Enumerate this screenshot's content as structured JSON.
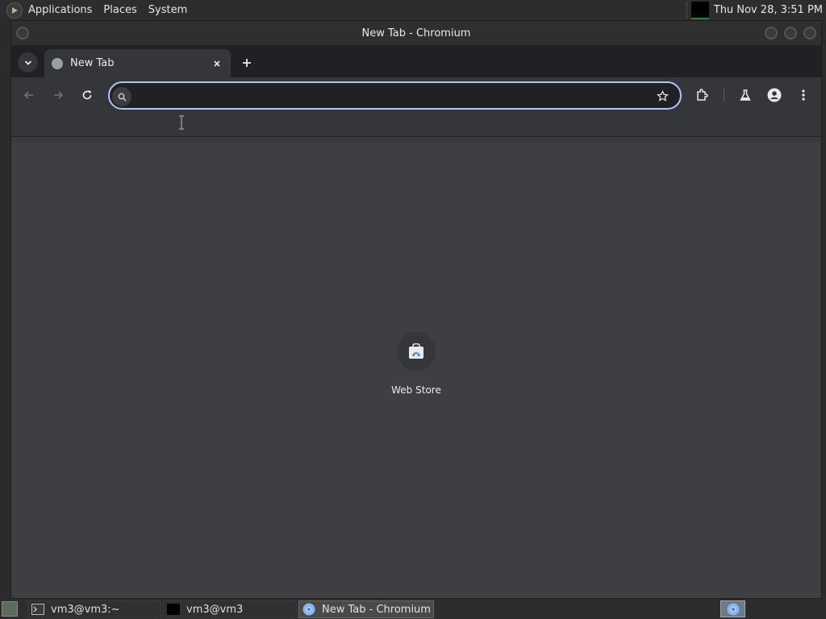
{
  "top_panel": {
    "menus": [
      "Applications",
      "Places",
      "System"
    ],
    "clock": "Thu Nov 28,  3:51 PM"
  },
  "window": {
    "title": "New Tab - Chromium"
  },
  "tabs": [
    {
      "label": "New Tab",
      "active": true
    }
  ],
  "omnibox": {
    "value": "",
    "placeholder": ""
  },
  "new_tab_page": {
    "shortcuts": [
      {
        "label": "Web Store",
        "icon": "web-store-icon"
      }
    ]
  },
  "taskbar": {
    "tasks": [
      {
        "label": "vm3@vm3:~",
        "icon": "terminal-icon",
        "active": false
      },
      {
        "label": "vm3@vm3",
        "icon": "terminal-black-icon",
        "active": false
      },
      {
        "label": "New Tab - Chromium",
        "icon": "chromium-icon",
        "active": true
      }
    ]
  },
  "colors": {
    "accent": "#a8c7fa",
    "toolbar": "#35363a",
    "tabstrip": "#202124",
    "content": "#3f3f43"
  }
}
